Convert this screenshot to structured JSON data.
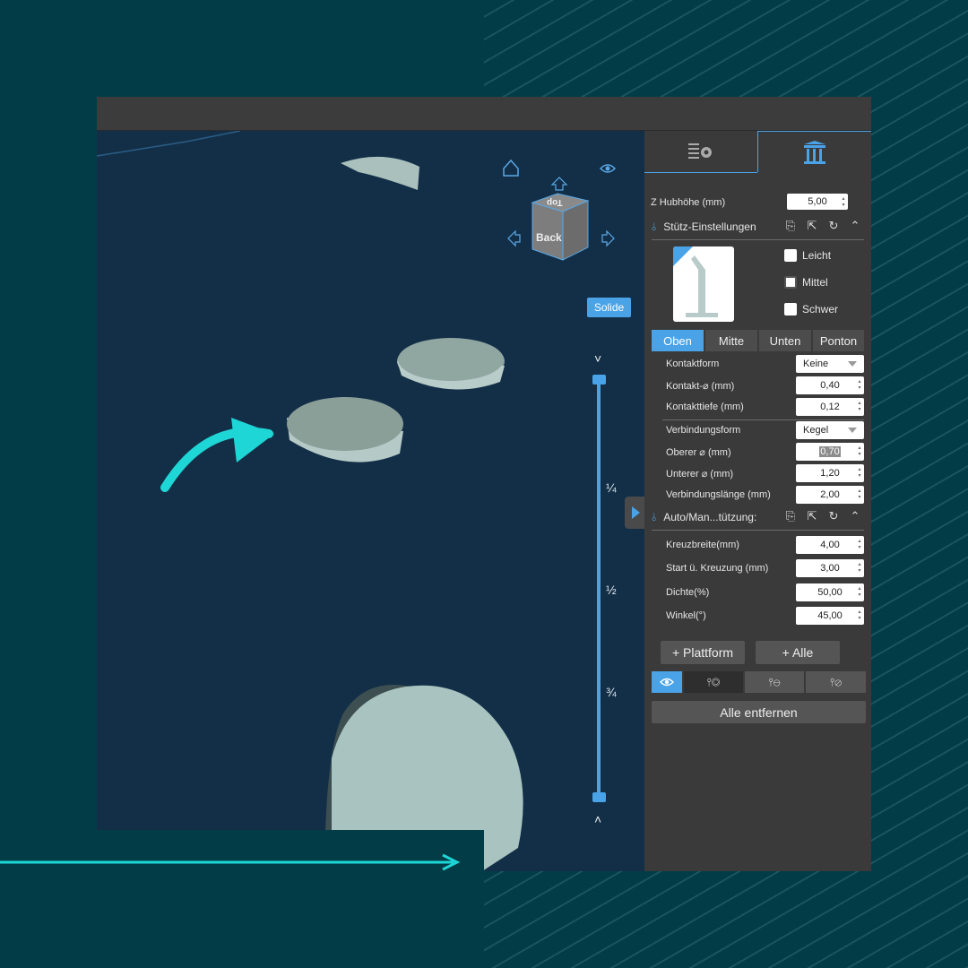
{
  "colors": {
    "accent": "#4aa3e6",
    "teal_arrow": "#1fd6d6",
    "panel_bg": "#3a3a3a",
    "viewport_bg": "#132f47"
  },
  "viewport": {
    "view_cube": {
      "face_front": "Back",
      "face_top": "Top"
    },
    "home_icon": "home-icon",
    "eye_icon": "eye-icon",
    "render_mode_button": "Solide",
    "slider": {
      "ticks": [
        "¼",
        "½",
        "¾"
      ],
      "up_arrow": "˅",
      "down_arrow": "˄"
    }
  },
  "panel": {
    "tabs": [
      {
        "name": "settings-tab",
        "icon": "list-gear-icon"
      },
      {
        "name": "supports-tab",
        "icon": "pillars-icon"
      }
    ],
    "lift_height": {
      "label": "Z Hubhöhe (mm)",
      "value": "5,00"
    },
    "support_settings": {
      "title": "Stütz-Einstellungen",
      "presets": [
        "Leicht",
        "Mittel",
        "Schwer"
      ],
      "tabs": [
        "Oben",
        "Mitte",
        "Unten",
        "Ponton"
      ],
      "active_tab": "Oben",
      "fields": [
        {
          "label": "Kontaktform",
          "value": "Keine",
          "type": "select"
        },
        {
          "label": "Kontakt-⌀ (mm)",
          "value": "0,40",
          "type": "spin"
        },
        {
          "label": "Kontakttiefe (mm)",
          "value": "0,12",
          "type": "spin"
        },
        {
          "label": "Verbindungsform",
          "value": "Kegel",
          "type": "select"
        },
        {
          "label": "Oberer ⌀ (mm)",
          "value": "0,70",
          "type": "spin"
        },
        {
          "label": "Unterer ⌀ (mm)",
          "value": "1,20",
          "type": "spin"
        },
        {
          "label": "Verbindungslänge (mm)",
          "value": "2,00",
          "type": "spin"
        }
      ]
    },
    "auto_support": {
      "title": "Auto/Man...tützung:",
      "fields": [
        {
          "label": "Kreuzbreite(mm)",
          "value": "4,00"
        },
        {
          "label": "Start ü. Kreuzung (mm)",
          "value": "3,00"
        },
        {
          "label": "Dichte(%)",
          "value": "50,00"
        },
        {
          "label": "Winkel(°)",
          "value": "45,00"
        }
      ]
    },
    "buttons": {
      "platform": "+ Plattform",
      "all": "+ Alle",
      "remove_all": "Alle entfernen"
    }
  }
}
